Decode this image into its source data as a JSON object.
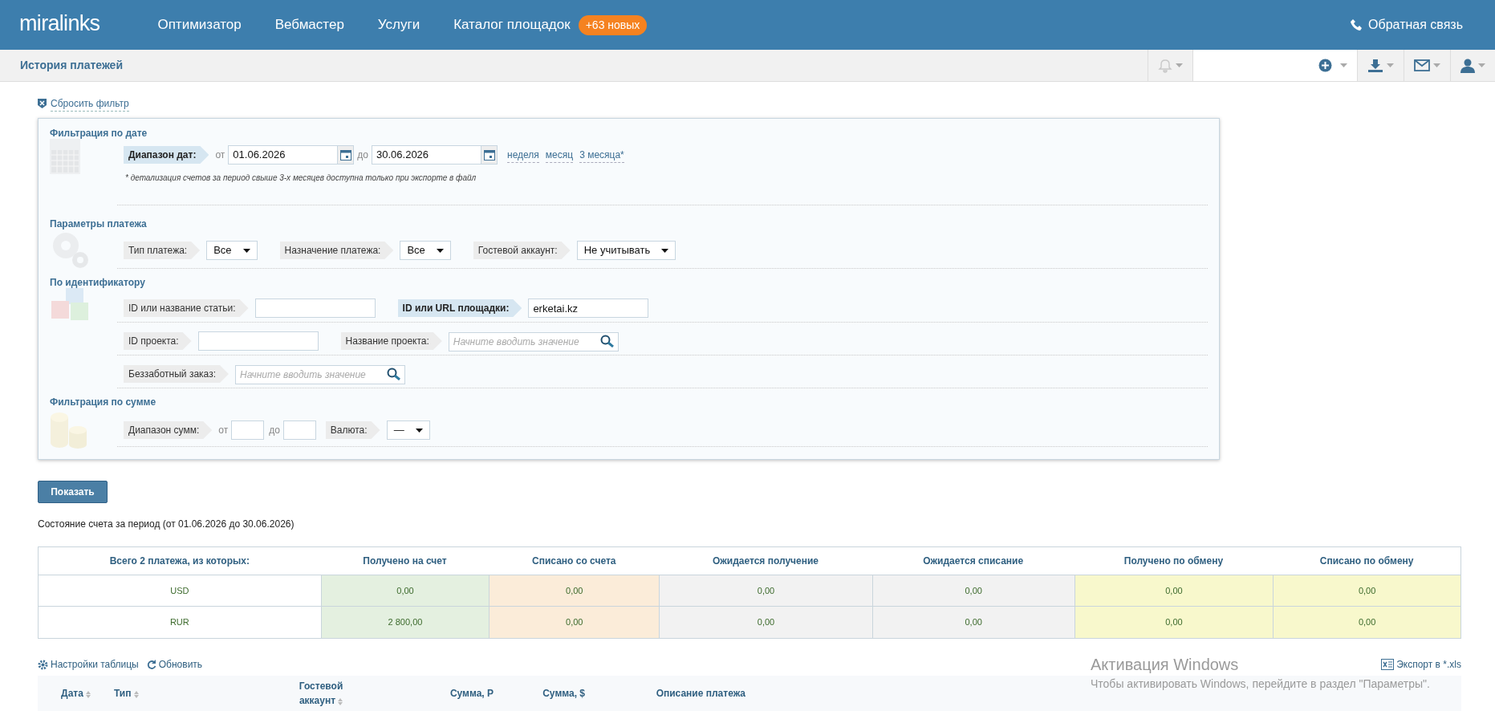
{
  "header": {
    "logo": "miralinks",
    "nav": [
      {
        "label": "Оптимизатор"
      },
      {
        "label": "Вебмастер"
      },
      {
        "label": "Услуги"
      },
      {
        "label": "Каталог площадок",
        "badge": "+63 новых"
      }
    ],
    "feedback": "Обратная связь"
  },
  "subheader": {
    "title": "История платежей"
  },
  "reset_filter": "Сбросить фильтр",
  "filter_sections": [
    {
      "title": "Фильтрация по дате",
      "rows": [
        {
          "items": [
            {
              "kind": "label",
              "text": "Диапазон дат:",
              "active": true
            },
            {
              "kind": "prefix",
              "text": "от"
            },
            {
              "kind": "date",
              "value": "01.06.2026"
            },
            {
              "kind": "prefix",
              "text": "до"
            },
            {
              "kind": "date",
              "value": "30.06.2026"
            },
            {
              "kind": "link",
              "text": "неделя"
            },
            {
              "kind": "link",
              "text": "месяц"
            },
            {
              "kind": "link",
              "text": "3 месяца*"
            }
          ],
          "note": "* детализация счетов за период свыше 3-х месяцев доступна только при экспорте в файл"
        }
      ]
    },
    {
      "title": "Параметры платежа",
      "rows": [
        {
          "items": [
            {
              "kind": "label",
              "text": "Тип платежа:",
              "active": false
            },
            {
              "kind": "select",
              "value": "Все"
            },
            {
              "kind": "label",
              "text": "Назначение платежа:",
              "active": false
            },
            {
              "kind": "select",
              "value": "Все"
            },
            {
              "kind": "label",
              "text": "Гостевой аккаунт:",
              "active": false
            },
            {
              "kind": "select",
              "value": "Не учитывать"
            }
          ]
        }
      ]
    },
    {
      "title": "По идентификатору",
      "rows": [
        {
          "items": [
            {
              "kind": "label",
              "text": "ID или название статьи:",
              "active": false
            },
            {
              "kind": "input"
            },
            {
              "kind": "label",
              "text": "ID или URL площадки:",
              "active": true
            },
            {
              "kind": "input",
              "value": "erketai.kz"
            }
          ]
        },
        {
          "items": [
            {
              "kind": "label",
              "text": "ID проекта:",
              "active": false
            },
            {
              "kind": "input"
            },
            {
              "kind": "label",
              "text": "Название проекта:",
              "active": false
            },
            {
              "kind": "search",
              "placeholder": "Начните вводить значение"
            }
          ]
        },
        {
          "items": [
            {
              "kind": "label",
              "text": "Беззаботный заказ:",
              "active": false
            },
            {
              "kind": "search",
              "placeholder": "Начните вводить значение"
            }
          ]
        }
      ]
    },
    {
      "title": "Фильтрация по сумме",
      "rows": [
        {
          "items": [
            {
              "kind": "label",
              "text": "Диапазон сумм:",
              "active": false
            },
            {
              "kind": "prefix",
              "text": "от"
            },
            {
              "kind": "small_input"
            },
            {
              "kind": "prefix",
              "text": "до"
            },
            {
              "kind": "small_input"
            },
            {
              "kind": "label",
              "text": "Валюта:",
              "active": false
            },
            {
              "kind": "select",
              "value": "—"
            }
          ]
        }
      ]
    }
  ],
  "show_button": "Показать",
  "period_status": "Состояние счета за период (от 01.06.2026 до 30.06.2026)",
  "summary_table": {
    "columns": [
      {
        "label": "Всего 2 платежа, из которых:",
        "color": "#ffffff"
      },
      {
        "label": "Получено на счет",
        "color": "#e4f0e0"
      },
      {
        "label": "Списано со счета",
        "color": "#fbecd9"
      },
      {
        "label": "Ожидается получение",
        "color": "#f2f2f2"
      },
      {
        "label": "Ожидается списание",
        "color": "#f2f2f2"
      },
      {
        "label": "Получено по обмену",
        "color": "#f8f8cc"
      },
      {
        "label": "Списано по обмену",
        "color": "#f8f8cc"
      }
    ],
    "rows": [
      {
        "cells": [
          "USD",
          "0,00",
          "0,00",
          "0,00",
          "0,00",
          "0,00",
          "0,00"
        ]
      },
      {
        "cells": [
          "RUR",
          "2 800,00",
          "0,00",
          "0,00",
          "0,00",
          "0,00",
          "0,00"
        ]
      }
    ]
  },
  "table_tools": {
    "settings": "Настройки таблицы",
    "refresh": "Обновить",
    "export": "Экспорт в *.xls"
  },
  "payments_table": {
    "columns": [
      {
        "label": "Дата",
        "sortable": true
      },
      {
        "label": "Тип",
        "sortable": true
      },
      {
        "label": "Гостевой аккаунт",
        "sortable": true
      },
      {
        "label": "Сумма, Р",
        "sortable": false
      },
      {
        "label": "Сумма, $",
        "sortable": false
      },
      {
        "label": "Описание платежа",
        "sortable": false
      }
    ]
  },
  "os_notice": {
    "title": "Активация Windows",
    "text": "Чтобы активировать Windows, перейдите в раздел \"Параметры\"."
  }
}
